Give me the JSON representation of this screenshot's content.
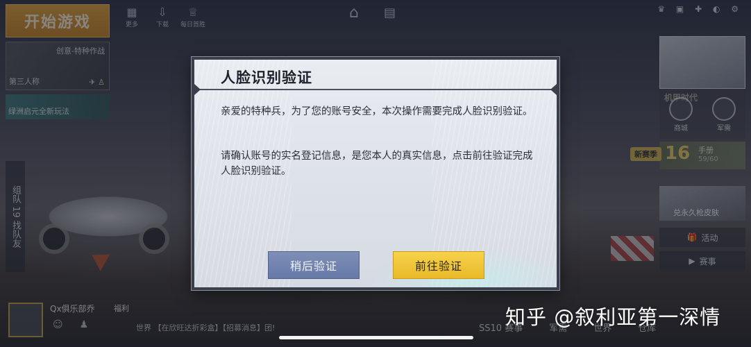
{
  "background": {
    "start_game": "开始游戏",
    "top_icons": [
      "更多",
      "下载",
      "每日首胜"
    ],
    "mode_card": {
      "title": "创意-特种作战",
      "view": "第三人称"
    },
    "banner": "绿洲启元全新玩法",
    "team_tab": [
      "组队",
      "19",
      "找队友"
    ],
    "right_panel": {
      "mecha": "机甲时代",
      "shop": "商城",
      "warehouse": "军需",
      "season_badge": "新赛季",
      "pass_level": "16",
      "pass_label": "手册",
      "pass_progress": "59/60",
      "permanent_skin": "兑永久枪皮肤",
      "activity": "活动",
      "match": "赛事"
    },
    "player": {
      "name": "Qx俱乐部乔",
      "welfare": "福利"
    },
    "world_chat": "世界 【在欣旺达折彩盒】【招募消息】团!",
    "bottom_tabs": [
      "SS10 赛事",
      "军需",
      "世界",
      "仓库"
    ]
  },
  "dialog": {
    "title": "人脸识别验证",
    "paragraph1": "亲爱的特种兵，为了您的账号安全，本次操作需要完成人脸识别验证。",
    "paragraph2": "请确认账号的实名登记信息，是您本人的真实信息，点击前往验证完成人脸识别验证。",
    "btn_later": "稍后验证",
    "btn_go": "前往验证"
  },
  "watermark": "知乎 @叙利亚第一深情",
  "colors": {
    "dialog_bg": "#dfe3ea",
    "border": "#3a3f4b",
    "btn_later": "#6f81ae",
    "btn_go": "#f0c53a"
  }
}
